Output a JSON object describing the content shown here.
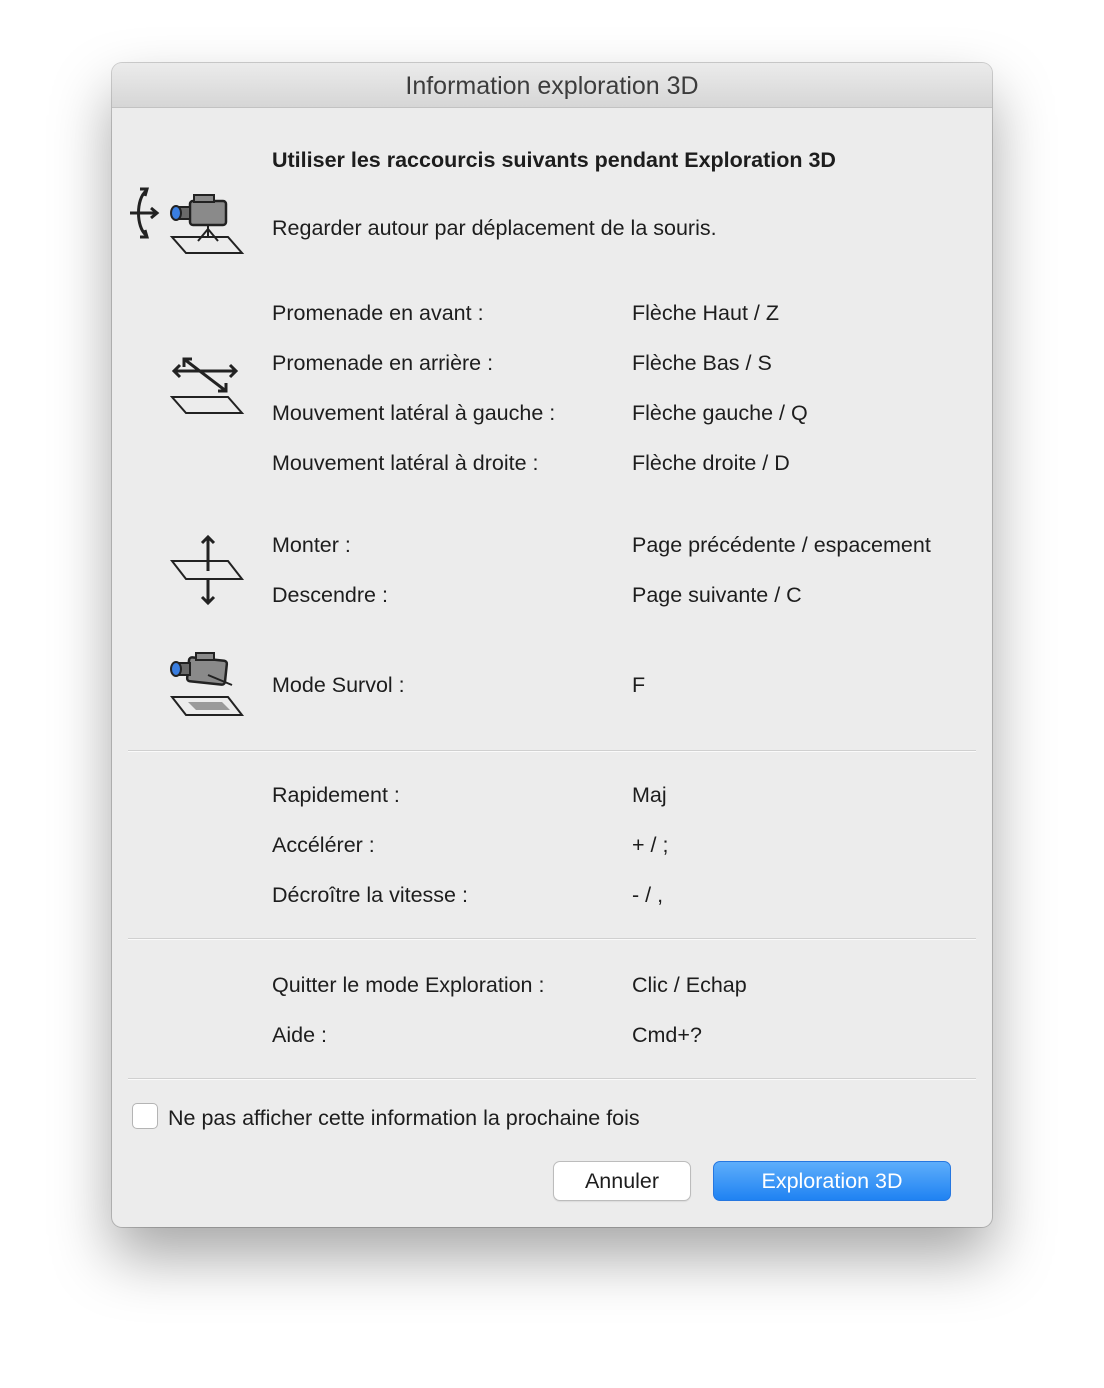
{
  "window": {
    "title": "Information exploration 3D"
  },
  "intro": {
    "heading": "Utiliser les raccourcis suivants pendant Exploration 3D",
    "look_text": "Regarder autour par déplacement de la souris."
  },
  "movement": [
    {
      "label": "Promenade en avant :",
      "key": "Flèche Haut / Z"
    },
    {
      "label": "Promenade en arrière :",
      "key": "Flèche Bas / S"
    },
    {
      "label": "Mouvement latéral à gauche :",
      "key": "Flèche gauche / Q"
    },
    {
      "label": "Mouvement latéral à droite :",
      "key": "Flèche droite / D"
    }
  ],
  "vertical": [
    {
      "label": "Monter :",
      "key": "Page précédente / espacement"
    },
    {
      "label": "Descendre :",
      "key": "Page suivante / C"
    }
  ],
  "survol": {
    "label": "Mode Survol :",
    "key": "F"
  },
  "speed": [
    {
      "label": "Rapidement :",
      "key": "Maj"
    },
    {
      "label": "Accélérer :",
      "key": "+ / ;"
    },
    {
      "label": "Décroître la vitesse :",
      "key": "- / ,"
    }
  ],
  "misc": [
    {
      "label": "Quitter le mode Exploration :",
      "key": "Clic / Echap"
    },
    {
      "label": "Aide :",
      "key": "Cmd+?"
    }
  ],
  "checkbox": {
    "label": "Ne pas afficher cette information la prochaine fois",
    "checked": false
  },
  "buttons": {
    "cancel": "Annuler",
    "primary": "Exploration 3D"
  },
  "colors": {
    "primary_button": "#1f82f2",
    "window_bg": "#ececec",
    "camera_lens": "#3a7ee0"
  },
  "icons": {
    "look": "look-around-camera-icon",
    "walk": "walk-arrows-icon",
    "updown": "up-down-arrows-icon",
    "survol": "flyover-camera-icon"
  }
}
